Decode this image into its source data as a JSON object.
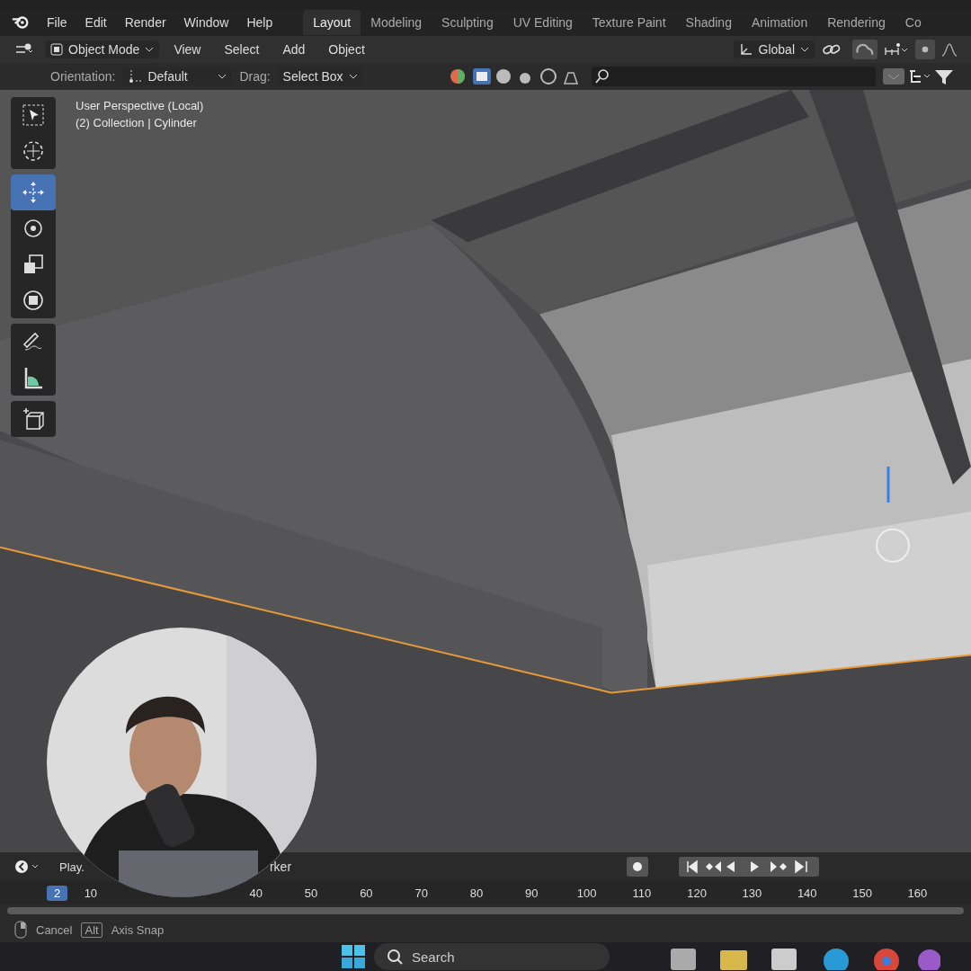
{
  "menu": [
    "File",
    "Edit",
    "Render",
    "Window",
    "Help"
  ],
  "workspaces": [
    {
      "label": "Layout",
      "selected": true
    },
    {
      "label": "Modeling",
      "selected": false
    },
    {
      "label": "Sculpting",
      "selected": false
    },
    {
      "label": "UV Editing",
      "selected": false
    },
    {
      "label": "Texture Paint",
      "selected": false
    },
    {
      "label": "Shading",
      "selected": false
    },
    {
      "label": "Animation",
      "selected": false
    },
    {
      "label": "Rendering",
      "selected": false
    },
    {
      "label": "Co",
      "selected": false
    }
  ],
  "header": {
    "mode": "Object Mode",
    "menus": [
      "View",
      "Select",
      "Add",
      "Object"
    ],
    "transform": "Global"
  },
  "tool_options": {
    "orientation_label": "Orientation:",
    "orientation": "Default",
    "drag_label": "Drag:",
    "drag": "Select Box"
  },
  "viewport": {
    "lines": [
      "User Perspective (Local)",
      "(2) Collection | Cylinder"
    ]
  },
  "tools": [
    {
      "kind": "select",
      "selected": false
    },
    {
      "kind": "cursor",
      "selected": false
    },
    {
      "kind": "move",
      "selected": true
    },
    {
      "kind": "rotate",
      "selected": false
    },
    {
      "kind": "scale",
      "selected": false
    },
    {
      "kind": "transform",
      "selected": false
    },
    {
      "kind": "annotate",
      "selected": false
    },
    {
      "kind": "measure",
      "selected": false
    },
    {
      "kind": "add",
      "selected": false
    }
  ],
  "timeline": {
    "menus": [
      "Play.",
      "rker"
    ],
    "current_frame": "2",
    "ticks": [
      "10",
      "40",
      "50",
      "60",
      "70",
      "80",
      "90",
      "100",
      "110",
      "120",
      "130",
      "140",
      "150",
      "160"
    ]
  },
  "status_bar": {
    "mouse_action": "Cancel",
    "key": "Alt",
    "key_action": "Axis Snap"
  },
  "taskbar": {
    "search": {
      "placeholder": "Search"
    }
  }
}
